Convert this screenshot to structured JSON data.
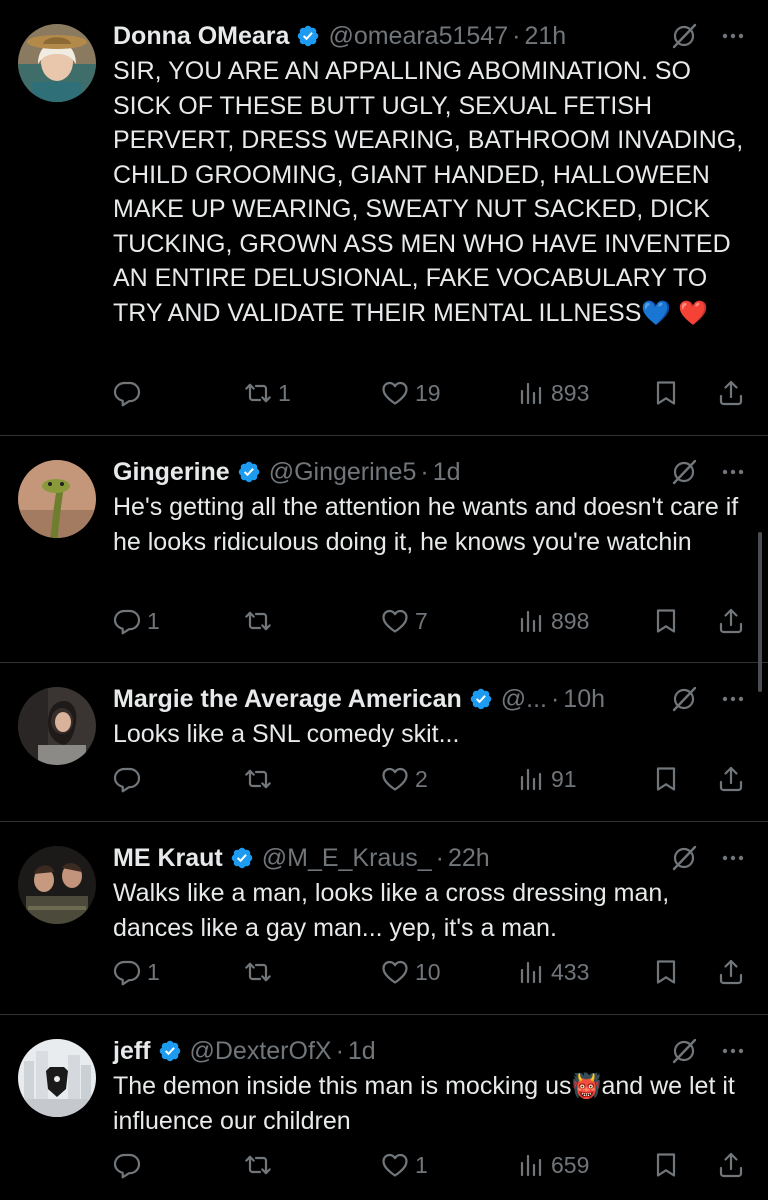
{
  "colors": {
    "background": "#000000",
    "text": "#e7e9ea",
    "muted": "#71767b",
    "verified": "#1d9bf0",
    "divider": "#2f3336"
  },
  "tweets": [
    {
      "name": "Donna OMeara",
      "handle": "@omeara51547",
      "time": "21h",
      "text": "SIR, YOU ARE AN APPALLING ABOMINATION. SO SICK OF THESE BUTT UGLY, SEXUAL FETISH PERVERT, DRESS WEARING, BATHROOM INVADING, CHILD GROOMING, GIANT HANDED, HALLOWEEN MAKE UP WEARING, SWEATY NUT SACKED, DICK  TUCKING, GROWN ASS MEN WHO HAVE INVENTED AN ENTIRE DELUSIONAL, FAKE VOCABULARY TO TRY AND VALIDATE THEIR MENTAL ILLNESS",
      "emoji": "💙 ❤️",
      "replies": "",
      "reposts": "1",
      "likes": "19",
      "views": "893"
    },
    {
      "name": "Gingerine",
      "handle": "@Gingerine5",
      "time": "1d",
      "text": "He's getting all the attention he wants and doesn't care if he looks ridiculous doing it, he knows you're watchin",
      "emoji": "",
      "replies": "1",
      "reposts": "",
      "likes": "7",
      "views": "898"
    },
    {
      "name": "Margie the Average American",
      "handle": "@...",
      "time": "10h",
      "text": "Looks like a SNL comedy skit...",
      "emoji": "",
      "replies": "",
      "reposts": "",
      "likes": "2",
      "views": "91"
    },
    {
      "name": "ME Kraut",
      "handle": "@M_E_Kraus_",
      "time": "22h",
      "text": "Walks like a man, looks like a cross dressing man, dances like a gay man... yep, it's a man.",
      "emoji": "",
      "replies": "1",
      "reposts": "",
      "likes": "10",
      "views": "433"
    },
    {
      "name": "jeff",
      "handle": "@DexterOfX",
      "time": "1d",
      "text": "The demon inside this man is mocking us",
      "emoji": "👹",
      "text_after": "and we let it influence our children",
      "replies": "",
      "reposts": "",
      "likes": "1",
      "views": "659"
    }
  ],
  "icons": {
    "verified": "verified-badge-icon",
    "grok": "grok-icon",
    "more": "more-icon",
    "reply": "reply-icon",
    "repost": "repost-icon",
    "like": "like-icon",
    "views": "views-icon",
    "bookmark": "bookmark-icon",
    "share": "share-icon"
  }
}
